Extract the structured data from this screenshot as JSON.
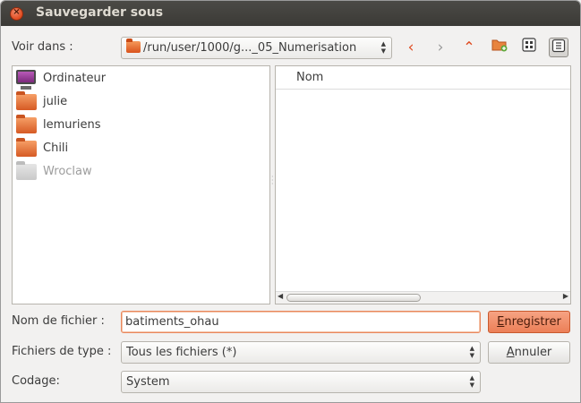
{
  "window": {
    "title": "Sauvegarder sous"
  },
  "location": {
    "label": "Voir dans :",
    "path": "/run/user/1000/g..._05_Numerisation"
  },
  "toolbar": {
    "back_glyph": "‹",
    "forward_glyph": "›",
    "up_glyph": "⌃"
  },
  "places": [
    {
      "label": "Ordinateur",
      "icon": "computer-icon"
    },
    {
      "label": "julie",
      "icon": "folder-icon"
    },
    {
      "label": "lemuriens",
      "icon": "folder-icon"
    },
    {
      "label": "Chili",
      "icon": "folder-icon"
    },
    {
      "label": "Wroclaw",
      "icon": "folder-icon",
      "disabled": true
    }
  ],
  "files": {
    "column_header": "Nom"
  },
  "filename": {
    "label": "Nom de fichier :",
    "value": "batiments_ohau"
  },
  "filetype": {
    "label": "Fichiers de type :",
    "selected": "Tous les fichiers (*)"
  },
  "encoding": {
    "label": "Codage:",
    "selected": "System"
  },
  "buttons": {
    "save_mnemonic": "E",
    "save_rest": "nregistrer",
    "cancel_mnemonic": "A",
    "cancel_rest": "nnuler"
  },
  "colors": {
    "accent": "#ec7f57",
    "titlebar": "#3b3a36"
  }
}
